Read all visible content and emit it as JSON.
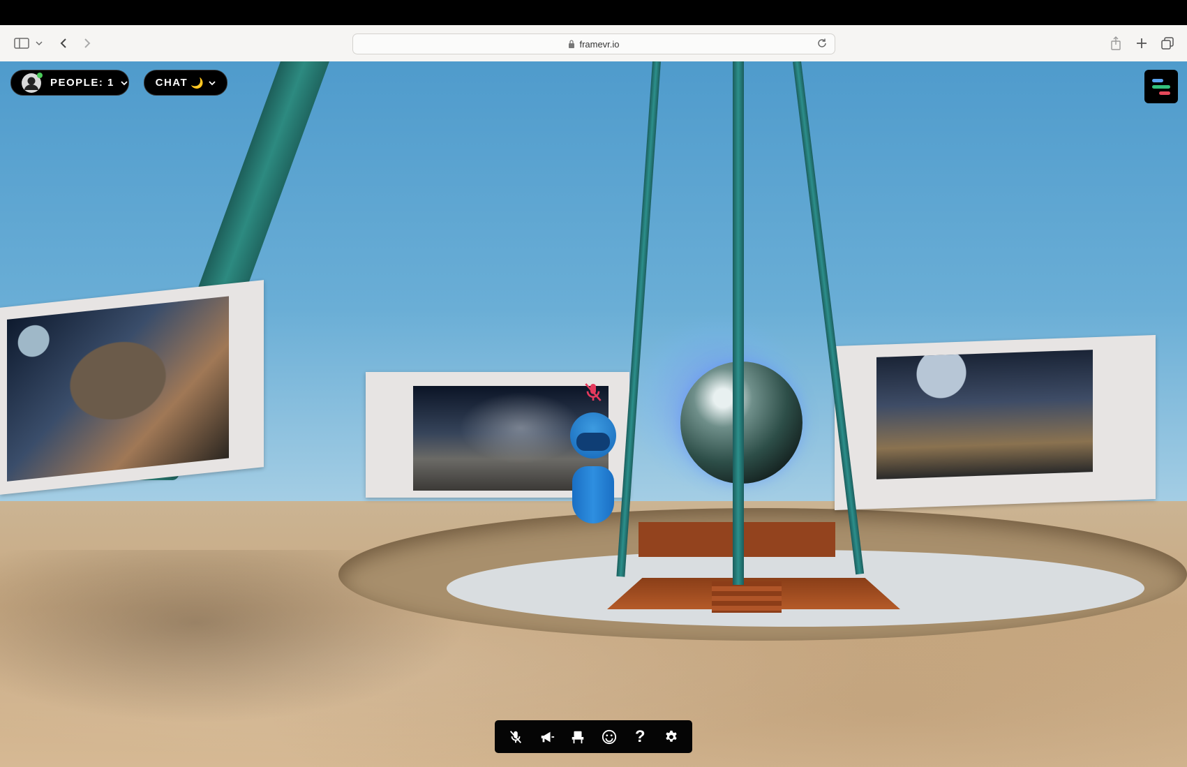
{
  "browser": {
    "url": "framevr.io"
  },
  "scene": {
    "people_label": "PEOPLE: 1",
    "chat_label": "CHAT",
    "chat_emoji": "🌙"
  },
  "icons": {
    "sidebar": "sidebar-icon",
    "back": "chevron-left-icon",
    "forward": "chevron-right-icon",
    "lock": "lock-icon",
    "reload": "reload-icon",
    "share": "share-icon",
    "new_tab": "plus-icon",
    "tabs": "tabs-overview-icon",
    "toolbar": [
      "mic-off-icon",
      "megaphone-icon",
      "seat-icon",
      "emoji-icon",
      "help-icon",
      "gear-icon"
    ]
  },
  "colors": {
    "menu_bars": [
      "#5aa3f0",
      "#34c17d",
      "#e6485a"
    ],
    "mute_indicator": "#e53a5d"
  }
}
